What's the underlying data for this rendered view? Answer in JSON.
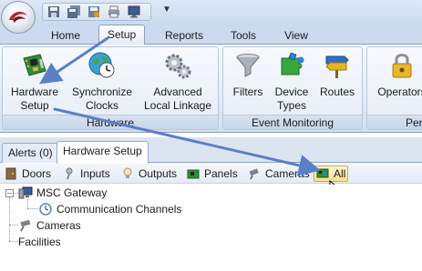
{
  "quick_access": {
    "icons": [
      "save-icon",
      "save-all-icon",
      "save-copy-icon",
      "print-icon",
      "monitor-icon"
    ],
    "dropdown_icon": "chevron-down-icon"
  },
  "ribbon_tabs": [
    {
      "label": "Home",
      "active": false
    },
    {
      "label": "Setup",
      "active": true
    },
    {
      "label": "Reports",
      "active": false
    },
    {
      "label": "Tools",
      "active": false
    },
    {
      "label": "View",
      "active": false
    }
  ],
  "ribbon": {
    "groups": [
      {
        "label": "Hardware"
      },
      {
        "label": "Event Monitoring"
      },
      {
        "label": "Per"
      }
    ],
    "buttons": {
      "hardware_setup": {
        "line1": "Hardware",
        "line2": "Setup",
        "icon": "circuit-board-icon"
      },
      "synchronize_clocks": {
        "line1": "Synchronize",
        "line2": "Clocks",
        "icon": "globe-clock-icon"
      },
      "advanced_local_linkage": {
        "line1": "Advanced",
        "line2": "Local Linkage",
        "icon": "gears-icon"
      },
      "filters": {
        "line1": "Filters",
        "line2": "",
        "icon": "funnel-icon"
      },
      "device_types": {
        "line1": "Device",
        "line2": "Types",
        "icon": "puzzle-icon"
      },
      "routes": {
        "line1": "Routes",
        "line2": "",
        "icon": "signpost-icon"
      },
      "operators": {
        "line1": "Operators",
        "line2": "",
        "icon": "padlock-icon"
      }
    }
  },
  "doc_tabs": [
    {
      "label": "Alerts (0)",
      "active": false
    },
    {
      "label": "Hardware Setup",
      "active": true
    }
  ],
  "sub_toolbar": {
    "items": [
      {
        "label": "Doors",
        "icon": "door-icon"
      },
      {
        "label": "Inputs",
        "icon": "input-pin-icon"
      },
      {
        "label": "Outputs",
        "icon": "lightbulb-icon"
      },
      {
        "label": "Panels",
        "icon": "panel-board-icon"
      },
      {
        "label": "Cameras",
        "icon": "camera-icon"
      },
      {
        "label": "All",
        "icon": "all-devices-icon",
        "selected": true
      }
    ]
  },
  "tree": {
    "nodes": [
      {
        "label": "MSC Gateway",
        "icon": "computer-icon",
        "expanded": true,
        "level": 0
      },
      {
        "label": "Communication Channels",
        "icon": "channel-clock-icon",
        "level": 1
      },
      {
        "label": "Cameras",
        "icon": "camera-icon",
        "level": 0
      },
      {
        "label": "Facilities",
        "icon": "",
        "level": 0
      }
    ]
  },
  "colors": {
    "ribbon_bg": "#dfe8f5",
    "annotation_arrow": "#5b7fc8",
    "selected_item": "#ffe08a"
  }
}
